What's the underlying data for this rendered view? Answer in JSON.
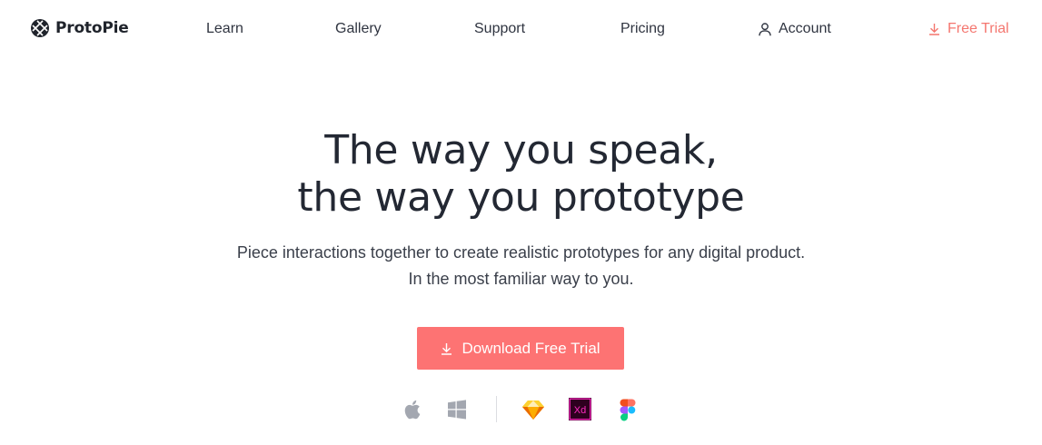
{
  "brand": {
    "name": "ProtoPie",
    "logo_icon": "protopie-logo-icon"
  },
  "nav": {
    "learn": "Learn",
    "gallery": "Gallery",
    "support": "Support",
    "pricing": "Pricing",
    "account": "Account",
    "account_icon": "user-icon",
    "free_trial": "Free Trial",
    "free_trial_icon": "download-icon"
  },
  "hero": {
    "title_line1": "The way you speak,",
    "title_line2": "the way you prototype",
    "subtitle_line1": "Piece interactions together to create realistic prototypes for any digital product.",
    "subtitle_line2": "In the most familiar way to you.",
    "cta_label": "Download Free Trial",
    "cta_icon": "download-icon"
  },
  "platforms": {
    "icons": [
      "apple-icon",
      "windows-icon",
      "sketch-icon",
      "adobe-xd-icon",
      "figma-icon"
    ],
    "xd_text": "Xd"
  },
  "colors": {
    "accent": "#fd7373",
    "accent_text": "#f4766f",
    "text_dark": "#232833",
    "platform_gray": "#a3a7b0",
    "xd_bg": "#2e001f",
    "xd_fg": "#ff2bc2"
  }
}
